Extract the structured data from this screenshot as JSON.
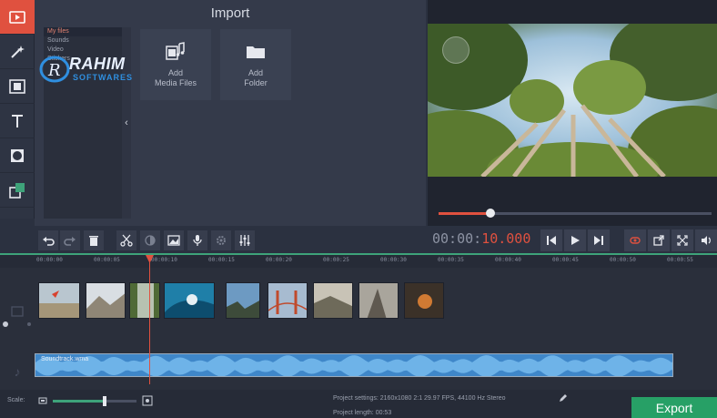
{
  "import": {
    "title": "Import",
    "file_categories": [
      "My files",
      "Sounds",
      "Video",
      "Stickers"
    ],
    "add_media_label": "Add\nMedia Files",
    "add_media_line1": "Add",
    "add_media_line2": "Media Files",
    "add_folder_line1": "Add",
    "add_folder_line2": "Folder"
  },
  "watermark": {
    "line1": "RAHIM",
    "line2": "SOFTWARES"
  },
  "player": {
    "timecode_grey": "00:00:",
    "timecode_red": "10.000",
    "progress": 0.19
  },
  "ruler": {
    "ticks": [
      "00:00:00",
      "00:00:05",
      "00:00:10",
      "00:00:15",
      "00:00:20",
      "00:00:25",
      "00:00:30",
      "00:00:35",
      "00:00:40",
      "00:00:45",
      "00:00:50",
      "00:00:55"
    ]
  },
  "audio_track": {
    "name": "Soundtrack.wma"
  },
  "status": {
    "scale_label": "Scale:",
    "scale_value": 0.62,
    "project_settings_label": "Project settings:",
    "project_settings_value": "2160x1080 2:1 29.97 FPS, 44100 Hz Stereo",
    "project_length_label": "Project length:",
    "project_length_value": "00:53"
  },
  "export_label": "Export",
  "colors": {
    "accent": "#e0513f",
    "export": "#27a066",
    "timeline_line": "#3ea37a"
  },
  "icons": [
    "video-icon",
    "magic-wand-icon",
    "filmstrip-icon",
    "text-icon",
    "overlay-icon",
    "callout-icon",
    "undo-icon",
    "redo-icon",
    "trash-icon",
    "scissors-icon",
    "color-icon",
    "image-icon",
    "mic-icon",
    "gear-icon",
    "equalizer-icon",
    "skip-back-icon",
    "play-icon",
    "skip-forward-icon",
    "webcam-icon",
    "share-icon",
    "fullscreen-icon",
    "volume-icon",
    "pencil-icon"
  ]
}
